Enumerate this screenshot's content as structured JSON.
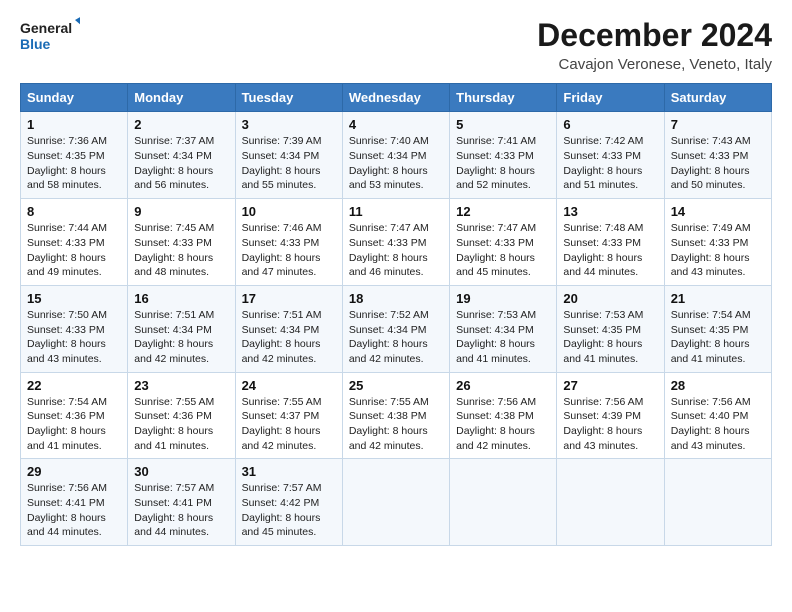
{
  "logo": {
    "text_general": "General",
    "text_blue": "Blue"
  },
  "header": {
    "title": "December 2024",
    "subtitle": "Cavajon Veronese, Veneto, Italy"
  },
  "weekdays": [
    "Sunday",
    "Monday",
    "Tuesday",
    "Wednesday",
    "Thursday",
    "Friday",
    "Saturday"
  ],
  "weeks": [
    [
      {
        "day": 1,
        "sunrise": "Sunrise: 7:36 AM",
        "sunset": "Sunset: 4:35 PM",
        "daylight": "Daylight: 8 hours and 58 minutes."
      },
      {
        "day": 2,
        "sunrise": "Sunrise: 7:37 AM",
        "sunset": "Sunset: 4:34 PM",
        "daylight": "Daylight: 8 hours and 56 minutes."
      },
      {
        "day": 3,
        "sunrise": "Sunrise: 7:39 AM",
        "sunset": "Sunset: 4:34 PM",
        "daylight": "Daylight: 8 hours and 55 minutes."
      },
      {
        "day": 4,
        "sunrise": "Sunrise: 7:40 AM",
        "sunset": "Sunset: 4:34 PM",
        "daylight": "Daylight: 8 hours and 53 minutes."
      },
      {
        "day": 5,
        "sunrise": "Sunrise: 7:41 AM",
        "sunset": "Sunset: 4:33 PM",
        "daylight": "Daylight: 8 hours and 52 minutes."
      },
      {
        "day": 6,
        "sunrise": "Sunrise: 7:42 AM",
        "sunset": "Sunset: 4:33 PM",
        "daylight": "Daylight: 8 hours and 51 minutes."
      },
      {
        "day": 7,
        "sunrise": "Sunrise: 7:43 AM",
        "sunset": "Sunset: 4:33 PM",
        "daylight": "Daylight: 8 hours and 50 minutes."
      }
    ],
    [
      {
        "day": 8,
        "sunrise": "Sunrise: 7:44 AM",
        "sunset": "Sunset: 4:33 PM",
        "daylight": "Daylight: 8 hours and 49 minutes."
      },
      {
        "day": 9,
        "sunrise": "Sunrise: 7:45 AM",
        "sunset": "Sunset: 4:33 PM",
        "daylight": "Daylight: 8 hours and 48 minutes."
      },
      {
        "day": 10,
        "sunrise": "Sunrise: 7:46 AM",
        "sunset": "Sunset: 4:33 PM",
        "daylight": "Daylight: 8 hours and 47 minutes."
      },
      {
        "day": 11,
        "sunrise": "Sunrise: 7:47 AM",
        "sunset": "Sunset: 4:33 PM",
        "daylight": "Daylight: 8 hours and 46 minutes."
      },
      {
        "day": 12,
        "sunrise": "Sunrise: 7:47 AM",
        "sunset": "Sunset: 4:33 PM",
        "daylight": "Daylight: 8 hours and 45 minutes."
      },
      {
        "day": 13,
        "sunrise": "Sunrise: 7:48 AM",
        "sunset": "Sunset: 4:33 PM",
        "daylight": "Daylight: 8 hours and 44 minutes."
      },
      {
        "day": 14,
        "sunrise": "Sunrise: 7:49 AM",
        "sunset": "Sunset: 4:33 PM",
        "daylight": "Daylight: 8 hours and 43 minutes."
      }
    ],
    [
      {
        "day": 15,
        "sunrise": "Sunrise: 7:50 AM",
        "sunset": "Sunset: 4:33 PM",
        "daylight": "Daylight: 8 hours and 43 minutes."
      },
      {
        "day": 16,
        "sunrise": "Sunrise: 7:51 AM",
        "sunset": "Sunset: 4:34 PM",
        "daylight": "Daylight: 8 hours and 42 minutes."
      },
      {
        "day": 17,
        "sunrise": "Sunrise: 7:51 AM",
        "sunset": "Sunset: 4:34 PM",
        "daylight": "Daylight: 8 hours and 42 minutes."
      },
      {
        "day": 18,
        "sunrise": "Sunrise: 7:52 AM",
        "sunset": "Sunset: 4:34 PM",
        "daylight": "Daylight: 8 hours and 42 minutes."
      },
      {
        "day": 19,
        "sunrise": "Sunrise: 7:53 AM",
        "sunset": "Sunset: 4:34 PM",
        "daylight": "Daylight: 8 hours and 41 minutes."
      },
      {
        "day": 20,
        "sunrise": "Sunrise: 7:53 AM",
        "sunset": "Sunset: 4:35 PM",
        "daylight": "Daylight: 8 hours and 41 minutes."
      },
      {
        "day": 21,
        "sunrise": "Sunrise: 7:54 AM",
        "sunset": "Sunset: 4:35 PM",
        "daylight": "Daylight: 8 hours and 41 minutes."
      }
    ],
    [
      {
        "day": 22,
        "sunrise": "Sunrise: 7:54 AM",
        "sunset": "Sunset: 4:36 PM",
        "daylight": "Daylight: 8 hours and 41 minutes."
      },
      {
        "day": 23,
        "sunrise": "Sunrise: 7:55 AM",
        "sunset": "Sunset: 4:36 PM",
        "daylight": "Daylight: 8 hours and 41 minutes."
      },
      {
        "day": 24,
        "sunrise": "Sunrise: 7:55 AM",
        "sunset": "Sunset: 4:37 PM",
        "daylight": "Daylight: 8 hours and 42 minutes."
      },
      {
        "day": 25,
        "sunrise": "Sunrise: 7:55 AM",
        "sunset": "Sunset: 4:38 PM",
        "daylight": "Daylight: 8 hours and 42 minutes."
      },
      {
        "day": 26,
        "sunrise": "Sunrise: 7:56 AM",
        "sunset": "Sunset: 4:38 PM",
        "daylight": "Daylight: 8 hours and 42 minutes."
      },
      {
        "day": 27,
        "sunrise": "Sunrise: 7:56 AM",
        "sunset": "Sunset: 4:39 PM",
        "daylight": "Daylight: 8 hours and 43 minutes."
      },
      {
        "day": 28,
        "sunrise": "Sunrise: 7:56 AM",
        "sunset": "Sunset: 4:40 PM",
        "daylight": "Daylight: 8 hours and 43 minutes."
      }
    ],
    [
      {
        "day": 29,
        "sunrise": "Sunrise: 7:56 AM",
        "sunset": "Sunset: 4:41 PM",
        "daylight": "Daylight: 8 hours and 44 minutes."
      },
      {
        "day": 30,
        "sunrise": "Sunrise: 7:57 AM",
        "sunset": "Sunset: 4:41 PM",
        "daylight": "Daylight: 8 hours and 44 minutes."
      },
      {
        "day": 31,
        "sunrise": "Sunrise: 7:57 AM",
        "sunset": "Sunset: 4:42 PM",
        "daylight": "Daylight: 8 hours and 45 minutes."
      },
      null,
      null,
      null,
      null
    ]
  ]
}
